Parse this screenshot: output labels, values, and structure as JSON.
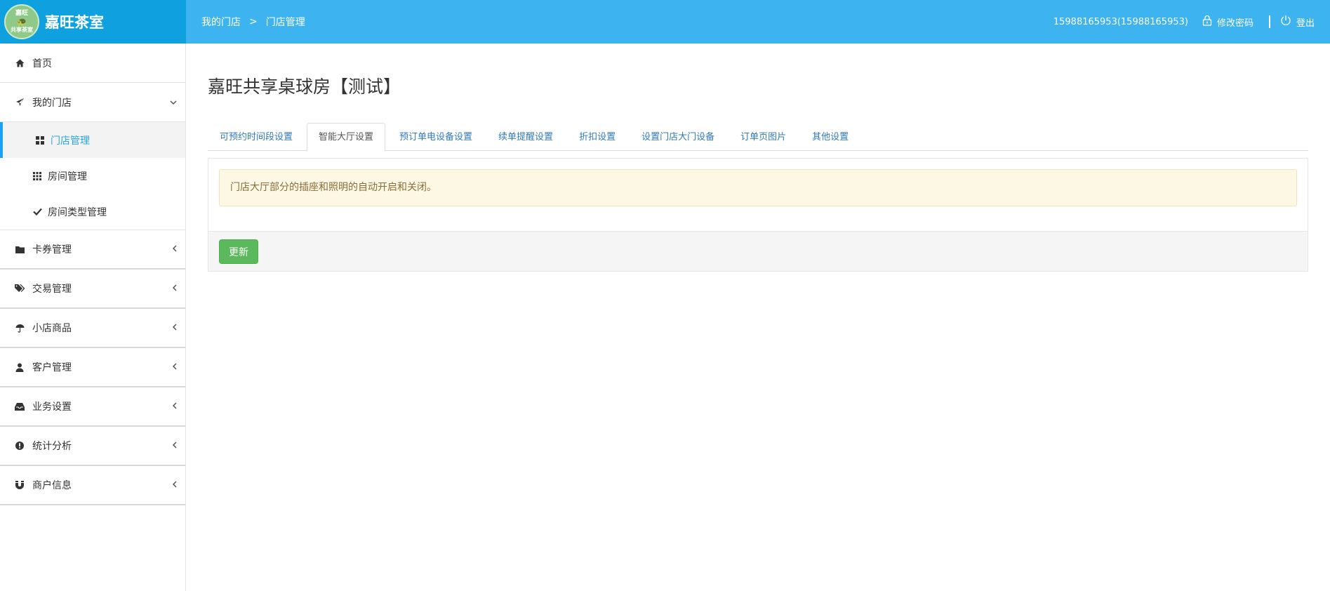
{
  "brand": {
    "logo_line1": "嘉旺",
    "logo_line2": "共享茶室",
    "name": "嘉旺茶室"
  },
  "header": {
    "breadcrumb": [
      "我的门店",
      "门店管理"
    ],
    "breadcrumb_sep": ">",
    "user": "15988165953(15988165953)",
    "change_password": "修改密码",
    "logout": "登出"
  },
  "sidebar": {
    "home": {
      "label": "首页",
      "icon": "home-icon"
    },
    "my_store": {
      "label": "我的门店",
      "icon": "plane-icon",
      "expanded": true
    },
    "sub_items": [
      {
        "label": "门店管理",
        "icon": "grid-large-icon",
        "active": true
      },
      {
        "label": "房间管理",
        "icon": "grid-small-icon",
        "active": false
      },
      {
        "label": "房间类型管理",
        "icon": "check-icon",
        "active": false
      }
    ],
    "groups": [
      {
        "label": "卡券管理",
        "icon": "folder-icon"
      },
      {
        "label": "交易管理",
        "icon": "tags-icon"
      },
      {
        "label": "小店商品",
        "icon": "umbrella-icon"
      },
      {
        "label": "客户管理",
        "icon": "user-icon"
      },
      {
        "label": "业务设置",
        "icon": "inbox-icon"
      },
      {
        "label": "统计分析",
        "icon": "exclamation-icon"
      },
      {
        "label": "商户信息",
        "icon": "magnet-icon"
      }
    ]
  },
  "main": {
    "title": "嘉旺共享桌球房【测试】",
    "tabs": [
      {
        "label": "可预约时间段设置",
        "active": false
      },
      {
        "label": "智能大厅设置",
        "active": true
      },
      {
        "label": "预订单电设备设置",
        "active": false
      },
      {
        "label": "续单提醒设置",
        "active": false
      },
      {
        "label": "折扣设置",
        "active": false
      },
      {
        "label": "设置门店大门设备",
        "active": false
      },
      {
        "label": "订单页图片",
        "active": false
      },
      {
        "label": "其他设置",
        "active": false
      }
    ],
    "alert_text": "门店大厅部分的插座和照明的自动开启和关闭。",
    "update_button": "更新"
  },
  "colors": {
    "brand_bg": "#0fa0e0",
    "navbar_bg": "#3db3ef",
    "active_link": "#29a5e6",
    "alert_bg": "#fcf8e3",
    "success_btn": "#5cb85c"
  }
}
